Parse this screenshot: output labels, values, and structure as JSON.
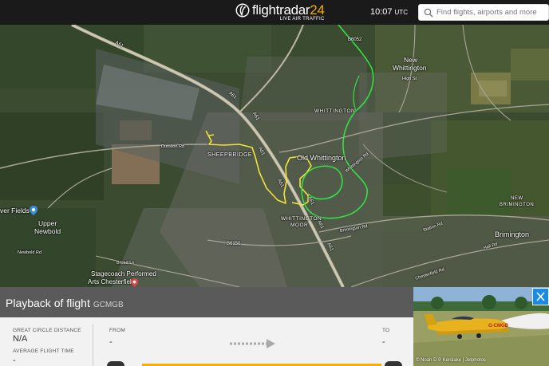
{
  "header": {
    "brand_main": "flightradar",
    "brand_num": "24",
    "brand_tagline": "LIVE AIR TRAFFIC",
    "time": "10:07",
    "timezone": "UTC",
    "search_placeholder": "Find flights, airports and more"
  },
  "map": {
    "road_labels": [
      "A61",
      "A61",
      "A61",
      "A61",
      "A61",
      "A61",
      "A61",
      "A61",
      "B6150",
      "B6052"
    ],
    "places": {
      "new_whittington_1": "New",
      "new_whittington_2": "Whittington",
      "whittington": "WHITTINGTON",
      "sheepbridge": "SHEEPBRIDGE",
      "old_whittington": "Old Whittington",
      "whittington_moor_1": "WHITTINGTON",
      "whittington_moor_2": "MOOR",
      "new_brimington_1": "NEW",
      "new_brimington_2": "BRIMINGTON",
      "brimington": "Brimington",
      "upper_newbold_1": "Upper",
      "upper_newbold_2": "Newbold",
      "water_fields": "ver Fields",
      "stagecoach_1": "Stagecoach Performed",
      "stagecoach_2": "Arts Chesterfield",
      "dunston_rd": "Dunston Rd",
      "high_st": "High St",
      "station_rd": "Station Rd",
      "chesterfield_rd": "Chesterfield Rd",
      "hall_rd": "Hall Rd",
      "newbold_rd": "Newbold Rd",
      "broad_ln": "Broad Ln",
      "brimington_rd": "Brimington Rd",
      "whittington_rd": "Whittington Rd"
    },
    "track_colors": {
      "yellow": "#f2e23a",
      "green": "#33e046"
    }
  },
  "panel": {
    "title": "Playback of flight",
    "registration": "GCMGB",
    "great_circle_label": "GREAT CIRCLE DISTANCE",
    "great_circle_value": "N/A",
    "avg_time_label": "AVERAGE FLIGHT TIME",
    "avg_time_value": "-",
    "from_label": "FROM",
    "from_value": "-",
    "to_label": "TO",
    "to_value": "-"
  },
  "photo": {
    "credit": "© Noah D P Kerslake | Jetphotos",
    "aircraft_reg": "G-CMGB"
  }
}
